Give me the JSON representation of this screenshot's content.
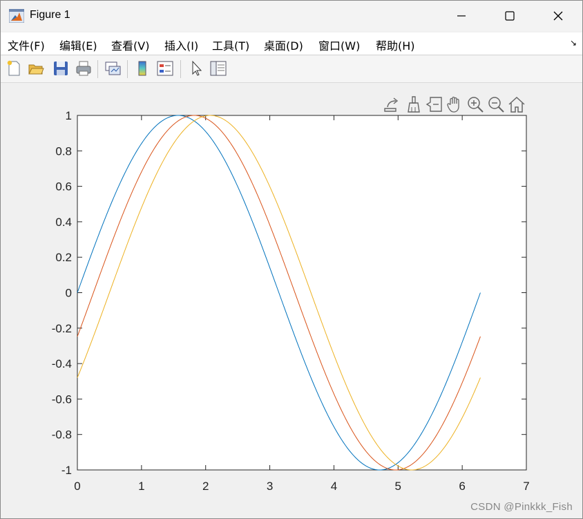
{
  "window": {
    "title": "Figure 1"
  },
  "menu": {
    "items": [
      {
        "label": "文件(F)",
        "key": "F"
      },
      {
        "label": "编辑(E)",
        "key": "E"
      },
      {
        "label": "查看(V)",
        "key": "V"
      },
      {
        "label": "插入(I)",
        "key": "I"
      },
      {
        "label": "工具(T)",
        "key": "T"
      },
      {
        "label": "桌面(D)",
        "key": "D"
      },
      {
        "label": "窗口(W)",
        "key": "W"
      },
      {
        "label": "帮助(H)",
        "key": "H"
      }
    ],
    "dock_arrow": "↘"
  },
  "toolbar": {
    "buttons": [
      "new-figure-icon",
      "open-file-icon",
      "save-icon",
      "print-icon",
      "link-plot-icon",
      "insert-colorbar-icon",
      "insert-legend-icon",
      "edit-plot-arrow-icon",
      "property-inspector-icon"
    ]
  },
  "axes_toolbar": {
    "buttons": [
      "export-icon",
      "brush-icon",
      "data-tips-icon",
      "pan-hand-icon",
      "zoom-in-icon",
      "zoom-out-icon",
      "restore-view-home-icon"
    ]
  },
  "chart_data": {
    "type": "line",
    "title": "",
    "xlabel": "",
    "ylabel": "",
    "xlim": [
      0,
      7
    ],
    "ylim": [
      -1,
      1
    ],
    "xticks": [
      "0",
      "1",
      "2",
      "3",
      "4",
      "5",
      "6",
      "7"
    ],
    "yticks": [
      "1",
      "0.8",
      "0.6",
      "0.4",
      "0.2",
      "0",
      "-0.2",
      "-0.4",
      "-0.6",
      "-0.8",
      "-1"
    ],
    "grid": false,
    "legend": "none",
    "x_range": [
      0,
      6.2832
    ],
    "series": [
      {
        "function": "sin(x)",
        "color": "#0072BD"
      },
      {
        "function": "sin(x - 0.25)",
        "color": "#D95319"
      },
      {
        "function": "sin(x - 0.5)",
        "color": "#EDB120"
      }
    ]
  },
  "watermark": "CSDN @Pinkkk_Fish"
}
